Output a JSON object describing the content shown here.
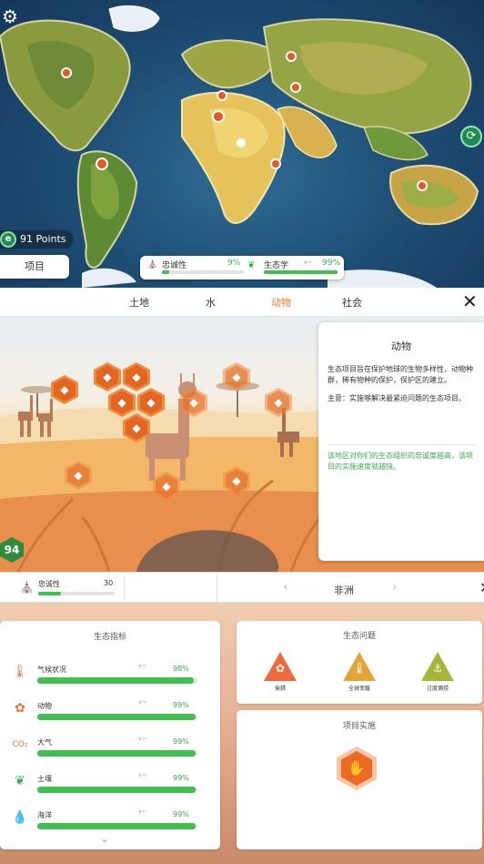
{
  "map": {
    "points": "91 Points",
    "projects_button": "项目",
    "status": {
      "loyalty_label": "忠诚性",
      "loyalty_pct": "9%",
      "loyalty_value": 0.09,
      "ecology_label": "生态学",
      "ecology_pct": "99%",
      "ecology_value": 0.99
    },
    "icons": {
      "settings": "gear-icon",
      "refresh": "refresh-icon",
      "points": "e-icon"
    }
  },
  "tabs": [
    {
      "label": "土地",
      "active": false
    },
    {
      "label": "水",
      "active": false
    },
    {
      "label": "动物",
      "active": true
    },
    {
      "label": "社会",
      "active": false
    }
  ],
  "close_label": "✕",
  "scene": {
    "score": "94"
  },
  "info_panel": {
    "title": "动物",
    "text1": "生态项目旨在保护地球的生物多样性，动物种群，稀有物种的保护，保护区的建立。",
    "text2": "主意：实施够解决最紧迫问题的生态项目。",
    "note": "该地区对你们的生态组织的忠诚度越高，该项目的实施速度就越快。"
  },
  "midbar": {
    "loyalty_label": "忠诚性",
    "loyalty_value": "30",
    "loyalty_fill": 0.3,
    "region_prev": "‹",
    "region_name": "非洲",
    "region_next": "›",
    "close": "✕"
  },
  "indicators": {
    "title": "生态指标",
    "items": [
      {
        "label": "气候状况",
        "pct": "98%",
        "value": 0.98,
        "icon": "thermometer-icon",
        "arrow": "‹··"
      },
      {
        "label": "动物",
        "pct": "99%",
        "value": 0.99,
        "icon": "paw-icon",
        "arrow": "‹··"
      },
      {
        "label": "大气",
        "pct": "99%",
        "value": 0.99,
        "icon": "co2-icon",
        "icon_text": "CO₂",
        "arrow": "‹··"
      },
      {
        "label": "土壤",
        "pct": "99%",
        "value": 0.99,
        "icon": "sprout-icon",
        "arrow": "‹··"
      },
      {
        "label": "海洋",
        "pct": "99%",
        "value": 0.99,
        "icon": "water-drop-icon",
        "arrow": "‹··"
      }
    ],
    "more": "⌄"
  },
  "issues": {
    "title": "生态问题",
    "items": [
      {
        "label": "偷猎",
        "color": "#ef6a3a",
        "icon": "paw-icon"
      },
      {
        "label": "全球变暖",
        "color": "#e2a53a",
        "icon": "thermometer-icon"
      },
      {
        "label": "过度捕捞",
        "color": "#a7b43a",
        "icon": "fishhook-icon"
      }
    ]
  },
  "implementation": {
    "title": "项目实施",
    "icon": "hand-animal-icon"
  }
}
